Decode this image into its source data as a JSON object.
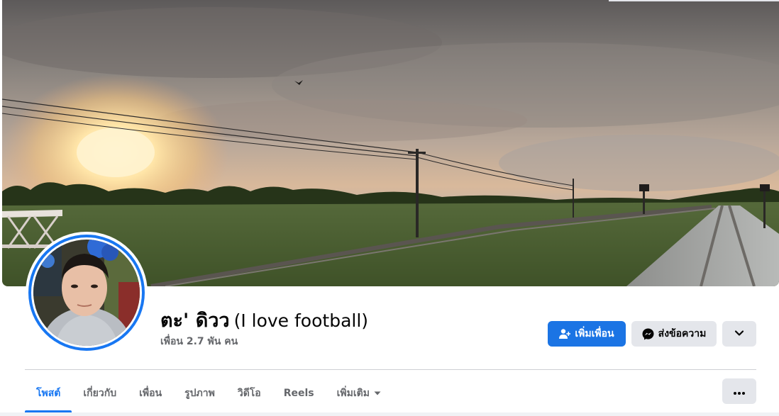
{
  "profile": {
    "name": "ตะ' ดิวว",
    "alternate_name": "(I love football)",
    "friends_count": "เพื่อน 2.7 พัน คน"
  },
  "actions": {
    "add_friend_label": "เพิ่มเพื่อน",
    "message_label": "ส่งข้อความ"
  },
  "tabs": [
    {
      "label": "โพสต์",
      "active": true
    },
    {
      "label": "เกี่ยวกับ",
      "active": false
    },
    {
      "label": "เพื่อน",
      "active": false
    },
    {
      "label": "รูปภาพ",
      "active": false
    },
    {
      "label": "วิดีโอ",
      "active": false
    },
    {
      "label": "Reels",
      "active": false
    },
    {
      "label": "เพิ่มเติม",
      "active": false
    }
  ],
  "icons": {
    "add_friend": "add-person-icon",
    "message": "messenger-icon",
    "expand": "chevron-down-icon",
    "more": "more-dots-icon",
    "tab_more": "caret-down-icon"
  },
  "colors": {
    "accent": "#1877f2",
    "primary_button": "#1b74e4",
    "secondary_button": "#e4e6eb",
    "muted_text": "#65676b"
  }
}
